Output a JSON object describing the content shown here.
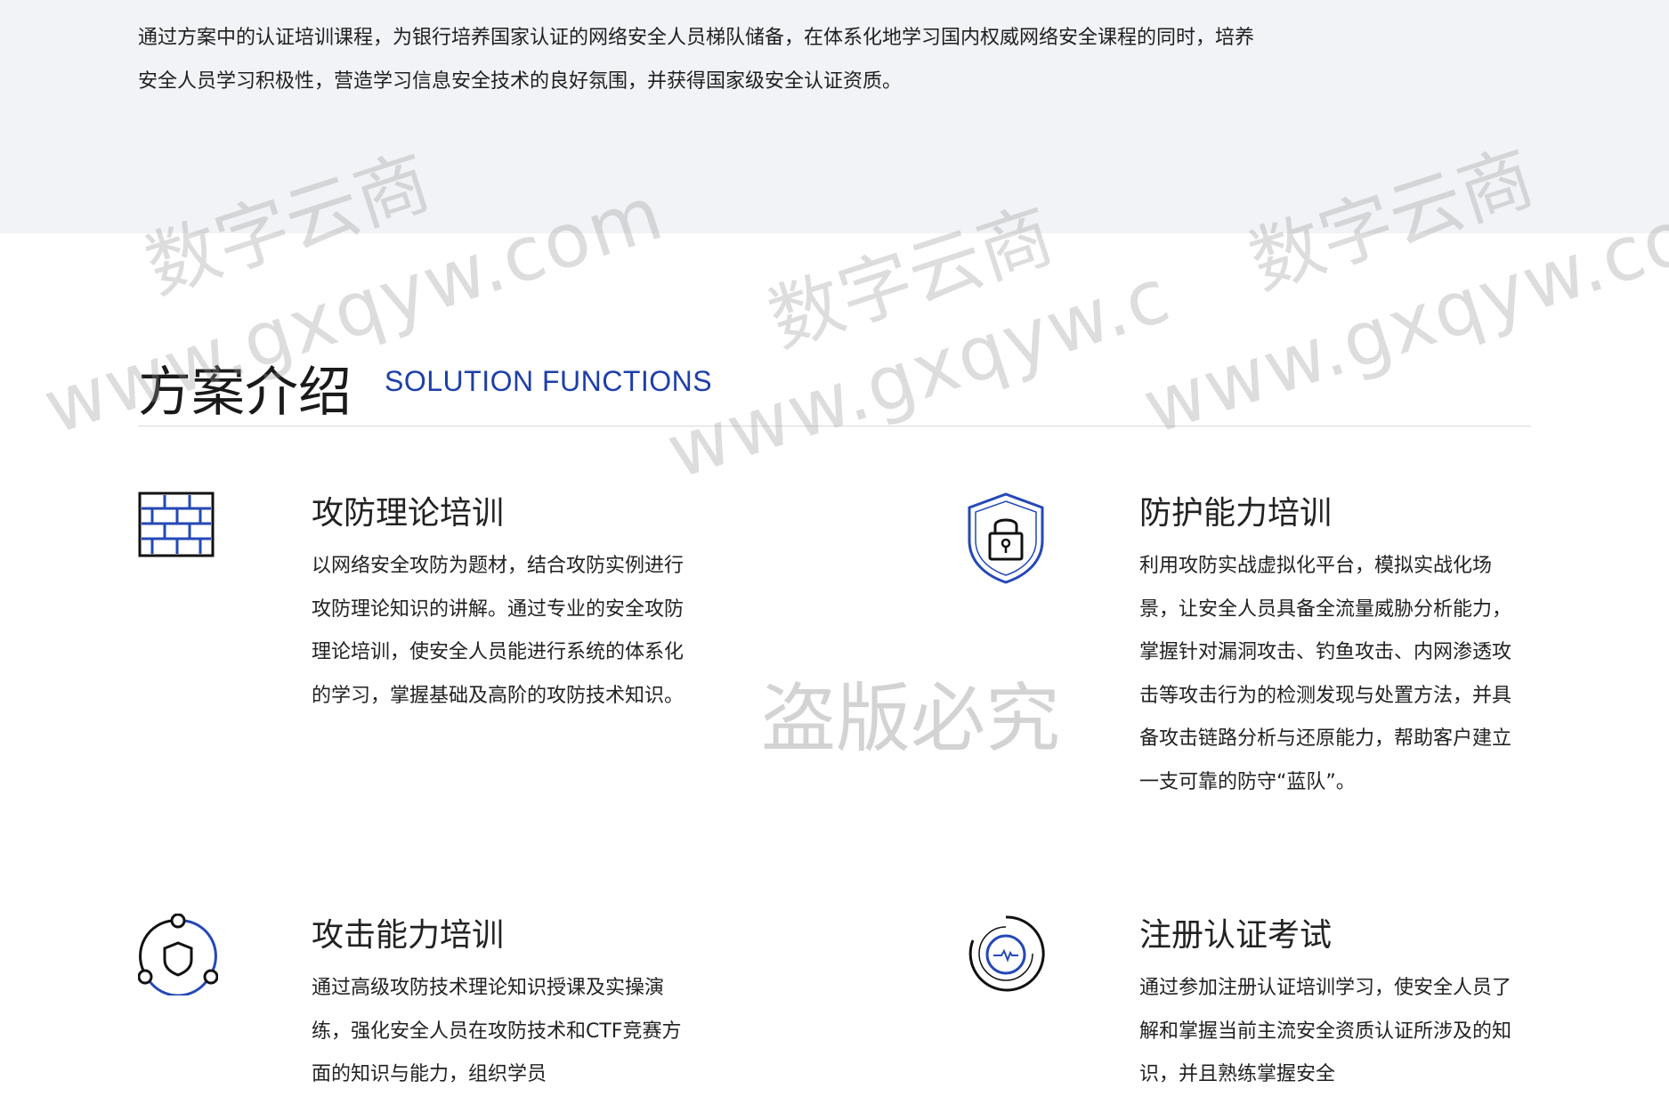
{
  "intro": {
    "text": "通过方案中的认证培训课程，为银行培养国家认证的网络安全人员梯队储备，在体系化地学习国内权威网络安全课程的同时，培养安全人员学习积极性，营造学习信息安全技术的良好氛围，并获得国家级安全认证资质。"
  },
  "section": {
    "title_cn": "方案介绍",
    "title_en": "SOLUTION FUNCTIONS"
  },
  "features": [
    {
      "icon": "firewall-brick-icon",
      "title": "攻防理论培训",
      "desc": "以网络安全攻防为题材，结合攻防实例进行攻防理论知识的讲解。通过专业的安全攻防理论培训，使安全人员能进行系统的体系化的学习，掌握基础及高阶的攻防技术知识。"
    },
    {
      "icon": "shield-lock-icon",
      "title": "防护能力培训",
      "desc": "利用攻防实战虚拟化平台，模拟实战化场景，让安全人员具备全流量威胁分析能力，掌握针对漏洞攻击、钓鱼攻击、内网渗透攻击等攻击行为的检测发现与处置方法，并具备攻击链路分析与还原能力，帮助客户建立一支可靠的防守“蓝队”。"
    },
    {
      "icon": "shield-network-icon",
      "title": "攻击能力培训",
      "desc": "通过高级攻防技术理论知识授课及实操演练，强化安全人员在攻防技术和CTF竞赛方面的知识与能力，组织学员"
    },
    {
      "icon": "certificate-pulse-icon",
      "title": "注册认证考试",
      "desc": "通过参加注册认证培训学习，使安全人员了解和掌握当前主流安全资质认证所涉及的知识，并且熟练掌握安全"
    }
  ],
  "watermarks": {
    "brand": "数字云商",
    "url": "www.gxqyw.com",
    "url_cut": "www.gxqyw.c",
    "anti_piracy": "盗版必究"
  },
  "colors": {
    "accent": "#1e3fa8",
    "band": "#f2f3f7"
  }
}
